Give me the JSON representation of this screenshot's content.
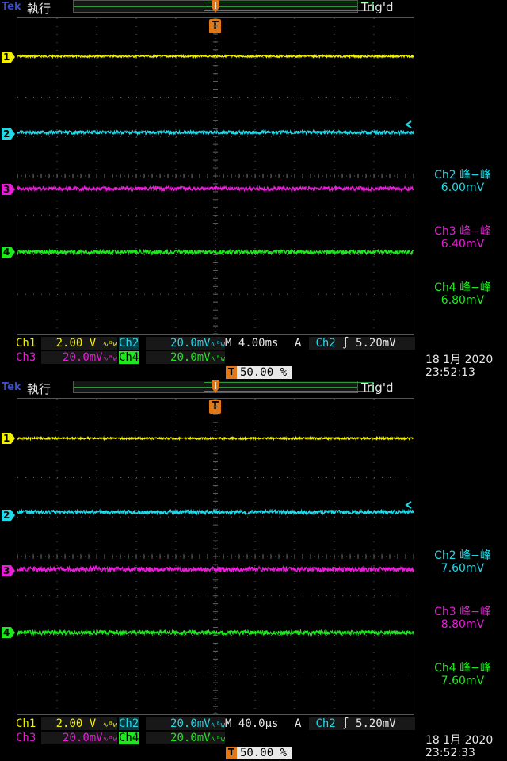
{
  "colors": {
    "ch1": "#f2f200",
    "ch2": "#23d8e8",
    "ch3": "#e81ed8",
    "ch4": "#1ee81e",
    "trigger": "#e07818",
    "grid": "#646464",
    "background": "#000000"
  },
  "screens": [
    {
      "brand": "Tek",
      "state": "執行",
      "trig_status": "Trig'd",
      "trig_pos_icon": "T",
      "channel_markers": [
        "1",
        "2",
        "3",
        "4"
      ],
      "measurements": [
        {
          "label": "Ch2 峰−峰",
          "value": "6.00mV",
          "color": "#23d8e8"
        },
        {
          "label": "Ch3 峰−峰",
          "value": "6.40mV",
          "color": "#e81ed8"
        },
        {
          "label": "Ch4 峰−峰",
          "value": "6.80mV",
          "color": "#1ee81e"
        }
      ],
      "ch1_label": "Ch1",
      "ch1_scale": "2.00 V",
      "ch2_label": "Ch2",
      "ch2_scale": "20.0mV",
      "ch3_label": "Ch3",
      "ch3_scale": "20.0mV",
      "ch4_label": "Ch4",
      "ch4_scale": "20.0mV",
      "coupling_icon": "∿ᴮw",
      "horiz": "M 4.00ms",
      "trig_mode": "A",
      "trig_src": "Ch2",
      "trig_slope": "∫",
      "trig_level": "5.20mV",
      "trig_position": "50.00 %",
      "date": "18 1月  2020",
      "time": "23:52:13"
    },
    {
      "brand": "Tek",
      "state": "執行",
      "trig_status": "Trig'd",
      "trig_pos_icon": "T",
      "channel_markers": [
        "1",
        "2",
        "3",
        "4"
      ],
      "measurements": [
        {
          "label": "Ch2 峰−峰",
          "value": "7.60mV",
          "color": "#23d8e8"
        },
        {
          "label": "Ch3 峰−峰",
          "value": "8.80mV",
          "color": "#e81ed8"
        },
        {
          "label": "Ch4 峰−峰",
          "value": "7.60mV",
          "color": "#1ee81e"
        }
      ],
      "ch1_label": "Ch1",
      "ch1_scale": "2.00 V",
      "ch2_label": "Ch2",
      "ch2_scale": "20.0mV",
      "ch3_label": "Ch3",
      "ch3_scale": "20.0mV",
      "ch4_label": "Ch4",
      "ch4_scale": "20.0mV",
      "coupling_icon": "∿ᴮw",
      "horiz": "M 40.0µs",
      "trig_mode": "A",
      "trig_src": "Ch2",
      "trig_slope": "∫",
      "trig_level": "5.20mV",
      "trig_position": "50.00 %",
      "date": "18 1月  2020",
      "time": "23:52:33"
    }
  ]
}
